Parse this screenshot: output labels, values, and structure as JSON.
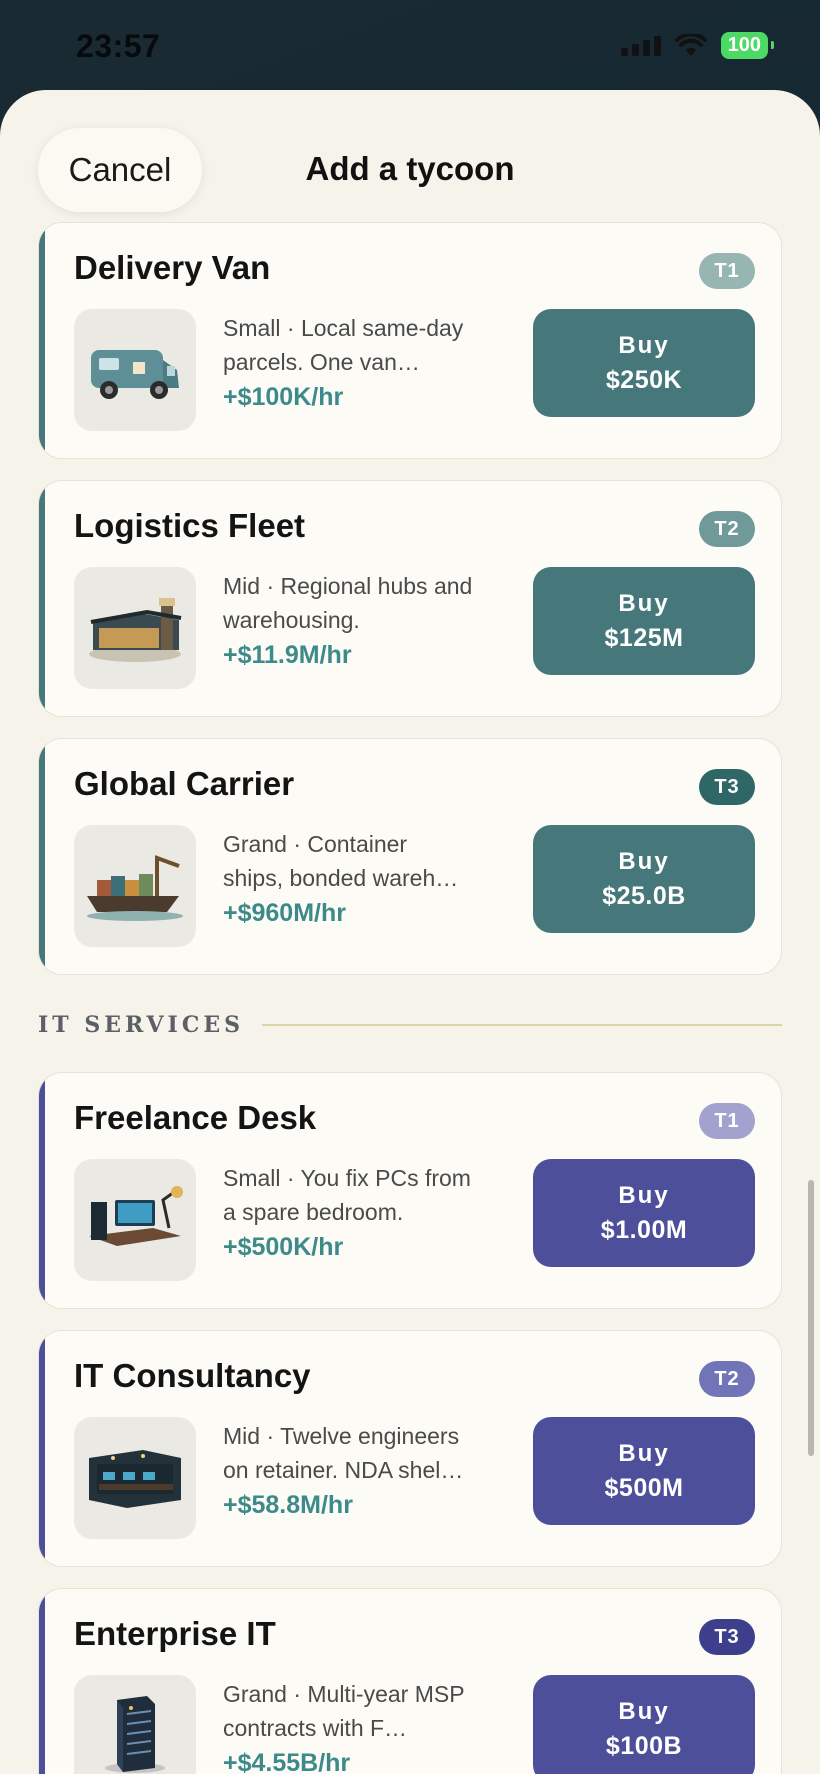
{
  "status_bar": {
    "time": "23:57",
    "battery": "100"
  },
  "header": {
    "cancel_label": "Cancel",
    "title": "Add a tycoon"
  },
  "buy_label": "Buy",
  "sections": [
    {
      "title": "",
      "accent": "#46777b",
      "items": [
        {
          "name": "Delivery Van",
          "tier": "T1",
          "tier_color": "#97b6b3",
          "description": "Small · Local same-day parcels. One van…",
          "rate": "+$100K/hr",
          "price": "$250K",
          "icon": "delivery-van-icon"
        },
        {
          "name": "Logistics Fleet",
          "tier": "T2",
          "tier_color": "#6f9a99",
          "description": "Mid · Regional hubs and warehousing.",
          "rate": "+$11.9M/hr",
          "price": "$125M",
          "icon": "warehouse-icon"
        },
        {
          "name": "Global Carrier",
          "tier": "T3",
          "tier_color": "#2f6767",
          "description": "Grand · Container ships, bonded wareh…",
          "rate": "+$960M/hr",
          "price": "$25.0B",
          "icon": "container-ship-icon"
        }
      ]
    },
    {
      "title": "IT SERVICES",
      "accent": "#4d4f9b",
      "items": [
        {
          "name": "Freelance Desk",
          "tier": "T1",
          "tier_color": "#a3a2cf",
          "description": "Small · You fix PCs from a spare bedroom.",
          "rate": "+$500K/hr",
          "price": "$1.00M",
          "icon": "desk-computer-icon"
        },
        {
          "name": "IT Consultancy",
          "tier": "T2",
          "tier_color": "#7174b7",
          "description": "Mid · Twelve engineers on retainer. NDA shel…",
          "rate": "+$58.8M/hr",
          "price": "$500M",
          "icon": "office-icon"
        },
        {
          "name": "Enterprise IT",
          "tier": "T3",
          "tier_color": "#3e3f8c",
          "description": "Grand · Multi-year MSP contracts with F…",
          "rate": "+$4.55B/hr",
          "price": "$100B",
          "icon": "server-tower-icon"
        }
      ]
    }
  ]
}
